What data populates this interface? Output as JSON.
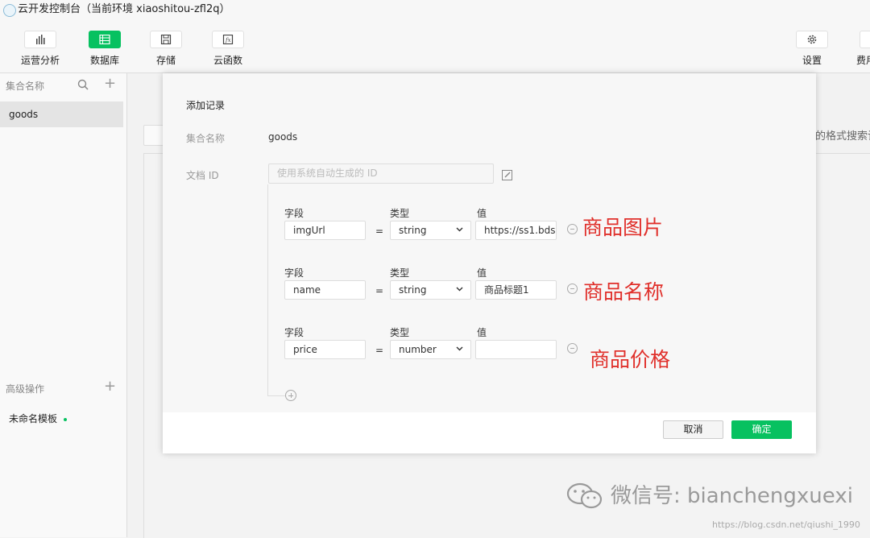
{
  "window": {
    "title": "云开发控制台（当前环境 xiaoshitou-zfl2q）"
  },
  "toolbar": {
    "items": [
      {
        "label": "运营分析",
        "icon": "bar-chart-icon"
      },
      {
        "label": "数据库",
        "icon": "database-icon",
        "active": true
      },
      {
        "label": "存储",
        "icon": "save-icon"
      },
      {
        "label": "云函数",
        "icon": "function-icon"
      }
    ],
    "settings_label": "设置",
    "cost_label": "费用"
  },
  "sidebar": {
    "collections_header": "集合名称",
    "collections": [
      "goods"
    ],
    "advanced_header": "高级操作",
    "template_label": "未命名模板"
  },
  "background": {
    "search_hint": "的格式搜索记"
  },
  "modal": {
    "title": "添加记录",
    "collection_label": "集合名称",
    "collection_value": "goods",
    "docid_label": "文档 ID",
    "docid_placeholder": "使用系统自动生成的 ID",
    "field_header": "字段",
    "type_header": "类型",
    "value_header": "值",
    "equals": "=",
    "rows": [
      {
        "field": "imgUrl",
        "type": "string",
        "value": "https://ss1.bds",
        "annotation": "商品图片"
      },
      {
        "field": "name",
        "type": "string",
        "value": "商品标题1",
        "annotation": "商品名称"
      },
      {
        "field": "price",
        "type": "number",
        "value": "",
        "annotation": "商品价格"
      }
    ],
    "cancel_label": "取消",
    "ok_label": "确定"
  },
  "watermark": {
    "text": "微信号: bianchengxuexi",
    "url": "https://blog.csdn.net/qiushi_1990"
  },
  "colors": {
    "accent": "#07c160",
    "annotation": "#e0302b"
  }
}
